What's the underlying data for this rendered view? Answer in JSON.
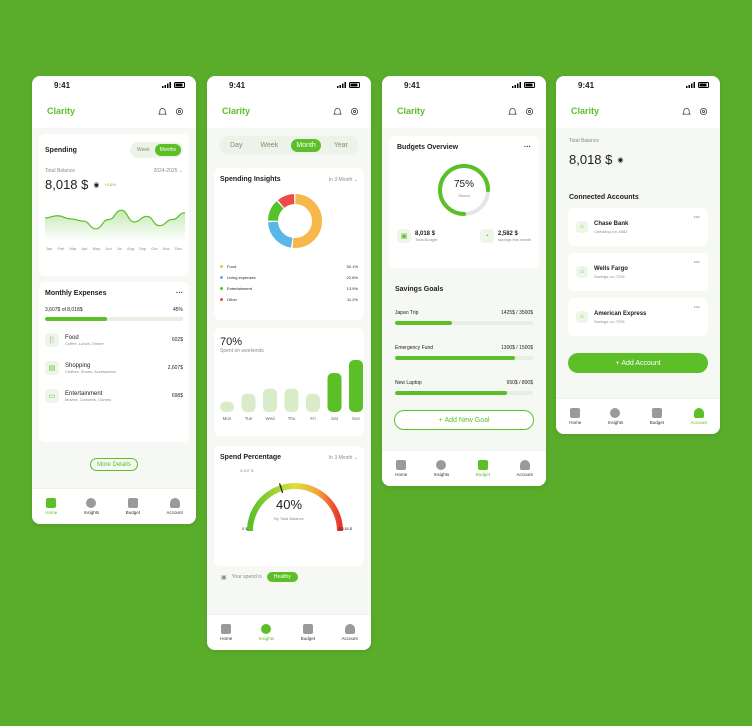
{
  "status": {
    "time": "9:41"
  },
  "app": {
    "name": "Clarity"
  },
  "nav": {
    "home": "Home",
    "insights": "Insights",
    "budget": "Budget",
    "account": "Account"
  },
  "s1": {
    "spending_title": "Spending",
    "toggle": [
      "Week",
      "Months"
    ],
    "total_label": "Total Balance",
    "period": "2024-2025",
    "balance": "8,018 $",
    "change": "+3.6%",
    "months": [
      "Jan",
      "Feb",
      "Mar",
      "Apr",
      "May",
      "Jun",
      "Jul",
      "Aug",
      "Sep",
      "Oct",
      "Nov",
      "Dec"
    ],
    "chart_data": {
      "type": "area",
      "categories": [
        "Jan",
        "Feb",
        "Mar",
        "Apr",
        "May",
        "Jun",
        "Jul",
        "Aug",
        "Sep",
        "Oct",
        "Nov",
        "Dec"
      ],
      "values": [
        0.55,
        0.62,
        0.52,
        0.45,
        0.2,
        0.5,
        0.8,
        0.42,
        0.6,
        0.3,
        0.5,
        0.72
      ]
    },
    "monthly_title": "Monthly Expenses",
    "monthly_amount": "3,607$",
    "of": "of",
    "monthly_total": "8,018$",
    "monthly_pct": "45%",
    "monthly_fraction": 0.45,
    "expenses": [
      {
        "name": "Food",
        "sub": "Coffee, Lunch, Dinner",
        "amount": "602$"
      },
      {
        "name": "Shopping",
        "sub": "Clothes, Shoes, Accessories",
        "amount": "2,607$"
      },
      {
        "name": "Entertainment",
        "sub": "Movies, Concerts, Games",
        "amount": "698$"
      }
    ],
    "more": "More Details"
  },
  "s2": {
    "tabs": [
      "Day",
      "Week",
      "Month",
      "Year"
    ],
    "insights_title": "Spending Insights",
    "range": "In 3 Month",
    "chart_data": {
      "type": "pie",
      "categories": [
        "Food",
        "Living expenses",
        "Entertainment",
        "Other"
      ],
      "values": [
        52.1,
        22.8,
        13.9,
        11.2
      ],
      "colors": [
        "#f7b84b",
        "#5ab6e8",
        "#53c32a",
        "#ef4a4a"
      ]
    },
    "legend": [
      {
        "name": "Food",
        "pct": "52.1%"
      },
      {
        "name": "Living expenses",
        "pct": "22.8%"
      },
      {
        "name": "Entertainment",
        "pct": "13.9%"
      },
      {
        "name": "Other",
        "pct": "11.2%"
      }
    ],
    "weekend_pct": "70%",
    "weekend_label": "Spent on weekends",
    "days": [
      "Mon",
      "Tue",
      "Wed",
      "Thu",
      "Fri",
      "Sat",
      "Sun"
    ],
    "day_values": [
      0.2,
      0.35,
      0.45,
      0.45,
      0.35,
      0.75,
      1.0
    ],
    "spend_title": "Spend Percentage",
    "spend_range": "In 3 Month",
    "gauge_mid": "3,207 $",
    "gauge_pct": "40%",
    "gauge_label": "By Total Balance",
    "gauge_min": "0 $",
    "gauge_max": "8,018 $",
    "gauge_fraction": 0.4,
    "spend_is": "Your spend is",
    "status": "Healthy"
  },
  "s3": {
    "overview_title": "Budgets Overview",
    "pct": "75%",
    "saved": "Saved",
    "fraction": 0.75,
    "total_budget": "8,018 $",
    "total_budget_label": "Total Budget",
    "savings": "2,582 $",
    "savings_label": "savings this month",
    "goals_title": "Savings Goals",
    "goals": [
      {
        "name": "Japan Trip",
        "amount": "1425$ / 3500$",
        "fraction": 0.41
      },
      {
        "name": "Emergency Fund",
        "amount": "1300$ / 1500$",
        "fraction": 0.87
      },
      {
        "name": "New Laptop",
        "amount": "650$ / 800$",
        "fraction": 0.81
      }
    ],
    "add_goal": "Add New Goal"
  },
  "s4": {
    "total_label": "Total Balance",
    "balance": "8,018 $",
    "accounts_title": "Connected Accounts",
    "accounts": [
      {
        "name": "Chase Bank",
        "sub": "Checking •••• 4582"
      },
      {
        "name": "Wells Fargo",
        "sub": "Savings •••• 7291"
      },
      {
        "name": "American Express",
        "sub": "Savings •••• 7291"
      }
    ],
    "add_account": "Add Account"
  }
}
